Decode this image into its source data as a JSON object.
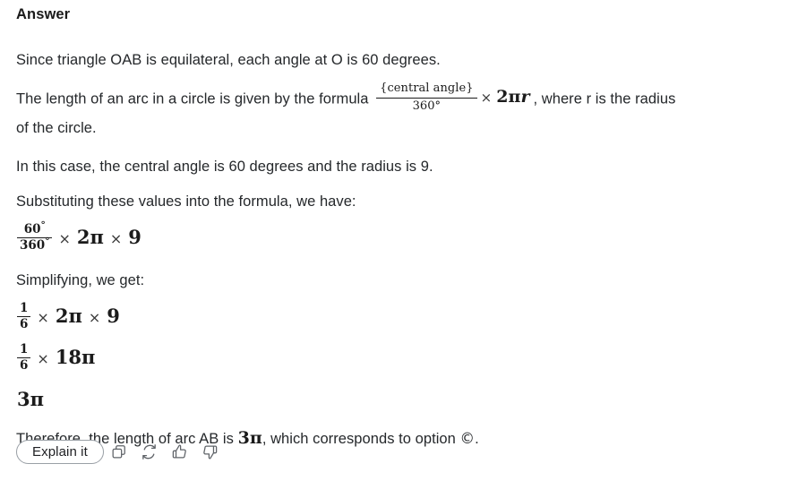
{
  "answer": {
    "heading": "Answer",
    "line_since": "Since triangle OAB is equilateral, each angle at O is 60 degrees.",
    "line_formula_pre": "The length of an arc in a circle is given by the formula",
    "line_formula_post": ", where r is the radius",
    "line_of_circle": "of the circle.",
    "line_in_this_case": "In this case, the central angle is 60 degrees and the radius is 9.",
    "line_substituting": "Substituting these values into the formula, we have:",
    "line_simplifying": "Simplifying, we get:",
    "therefore_pre": "Therefore, the length of arc AB is ",
    "therefore_mid": ", which corresponds to option ",
    "therefore_option": "©",
    "therefore_end": "."
  },
  "formula_general": {
    "numerator": "{central angle}",
    "denominator": "360°",
    "times": "×",
    "rhs_coefficient": "2",
    "rhs_pi": "π",
    "rhs_radius": "r"
  },
  "step_substituted": {
    "num_value": "60",
    "num_degree": "°",
    "den_value": "360",
    "den_degree": "°",
    "times1": "×",
    "term1_coeff": "2",
    "term1_pi": "π",
    "times2": "×",
    "term2": "9"
  },
  "step_simplified_1": {
    "num": "1",
    "den": "6",
    "times1": "×",
    "term1_coeff": "2",
    "term1_pi": "π",
    "times2": "×",
    "term2": "9"
  },
  "step_simplified_2": {
    "num": "1",
    "den": "6",
    "times1": "×",
    "term1": "18",
    "term1_pi": "π"
  },
  "result": {
    "coefficient": "3",
    "pi": "π"
  },
  "actions": {
    "explain_label": "Explain it",
    "icons": [
      {
        "name": "copy-icon",
        "title": "Copy"
      },
      {
        "name": "regenerate-icon",
        "title": "Regenerate"
      },
      {
        "name": "thumbs-up-icon",
        "title": "Good response"
      },
      {
        "name": "thumbs-down-icon",
        "title": "Bad response"
      }
    ]
  },
  "colors": {
    "text": "#25282b",
    "heading": "#1a1a1a",
    "icon_stroke": "#5f6368",
    "button_border": "#9aa0a6",
    "background": "#ffffff"
  }
}
